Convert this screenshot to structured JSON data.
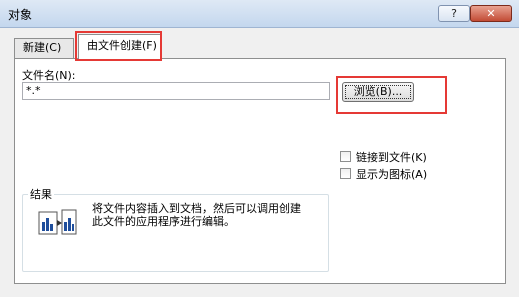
{
  "window": {
    "title": "对象",
    "help_label": "?",
    "close_label": "✕"
  },
  "tabs": [
    {
      "label": "新建(C)",
      "selected": false
    },
    {
      "label": "由文件创建(F)",
      "selected": true
    }
  ],
  "filename": {
    "label": "文件名(N):",
    "value": "*.*"
  },
  "browse_label": "浏览(B)...",
  "options": {
    "link": {
      "label": "链接到文件(K)",
      "checked": false
    },
    "show_icon": {
      "label": "显示为图标(A)",
      "checked": false
    }
  },
  "result": {
    "title": "结果",
    "line1": "将文件内容插入到文档，然后可以调用创建",
    "line2": "此文件的应用程序进行编辑。"
  },
  "colors": {
    "highlight": "#e53935",
    "accent": "#1f4e9c"
  }
}
